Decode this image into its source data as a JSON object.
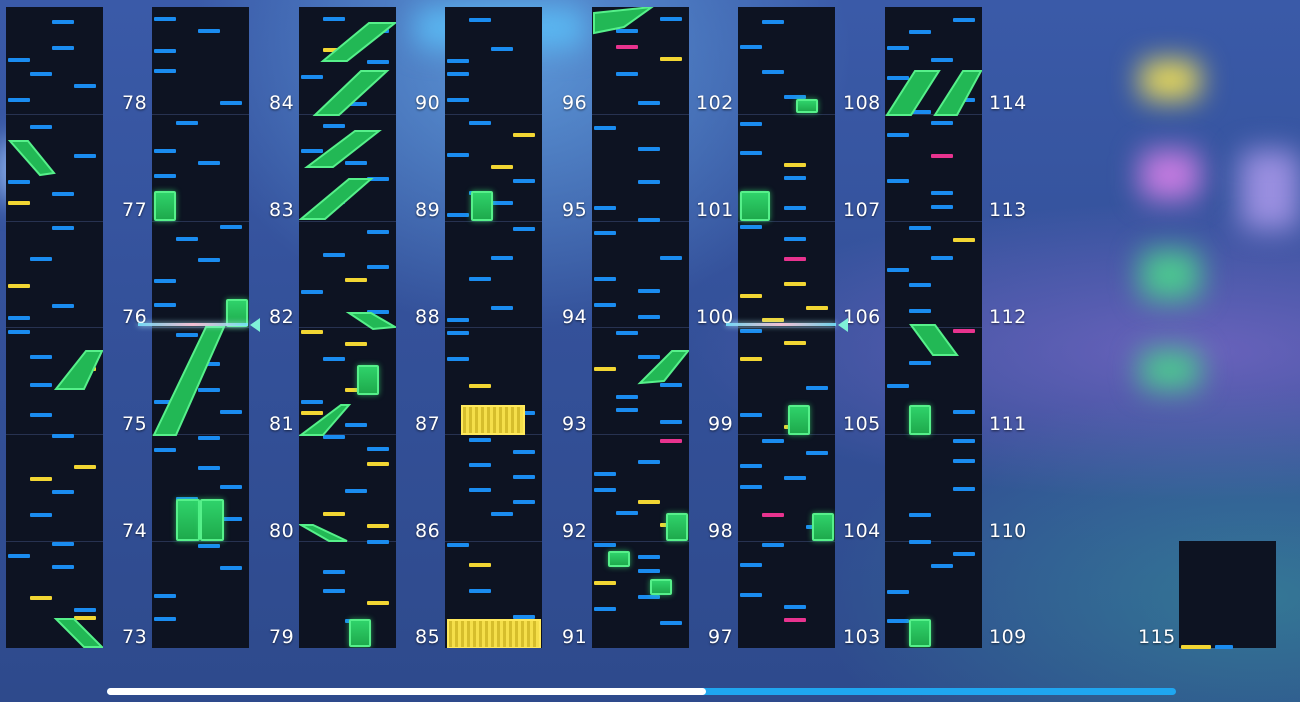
{
  "chart_view": {
    "measures_start": 73,
    "measures_end": 115,
    "current_measure_marker_a": "76",
    "current_measure_marker_b": "100"
  },
  "columns": [
    {
      "labels": [
        "78",
        "77",
        "76",
        "75",
        "74",
        "73"
      ]
    },
    {
      "labels": [
        "84",
        "83",
        "82",
        "81",
        "80",
        "79"
      ]
    },
    {
      "labels": [
        "90",
        "89",
        "88",
        "87",
        "86",
        "85"
      ]
    },
    {
      "labels": [
        "96",
        "95",
        "94",
        "93",
        "92",
        "91"
      ]
    },
    {
      "labels": [
        "102",
        "101",
        "100",
        "99",
        "98",
        "97"
      ]
    },
    {
      "labels": [
        "108",
        "107",
        "106",
        "105",
        "104",
        "103"
      ]
    },
    {
      "labels": [
        "114",
        "113",
        "112",
        "111",
        "110",
        "109"
      ]
    },
    {
      "labels": [
        "115"
      ]
    }
  ],
  "note_types": {
    "tap": "#1a8cf0",
    "drag": "#f2d633",
    "flick": "#e8338f",
    "hold": "#2fd26a"
  },
  "progress": {
    "value": 0.56
  }
}
